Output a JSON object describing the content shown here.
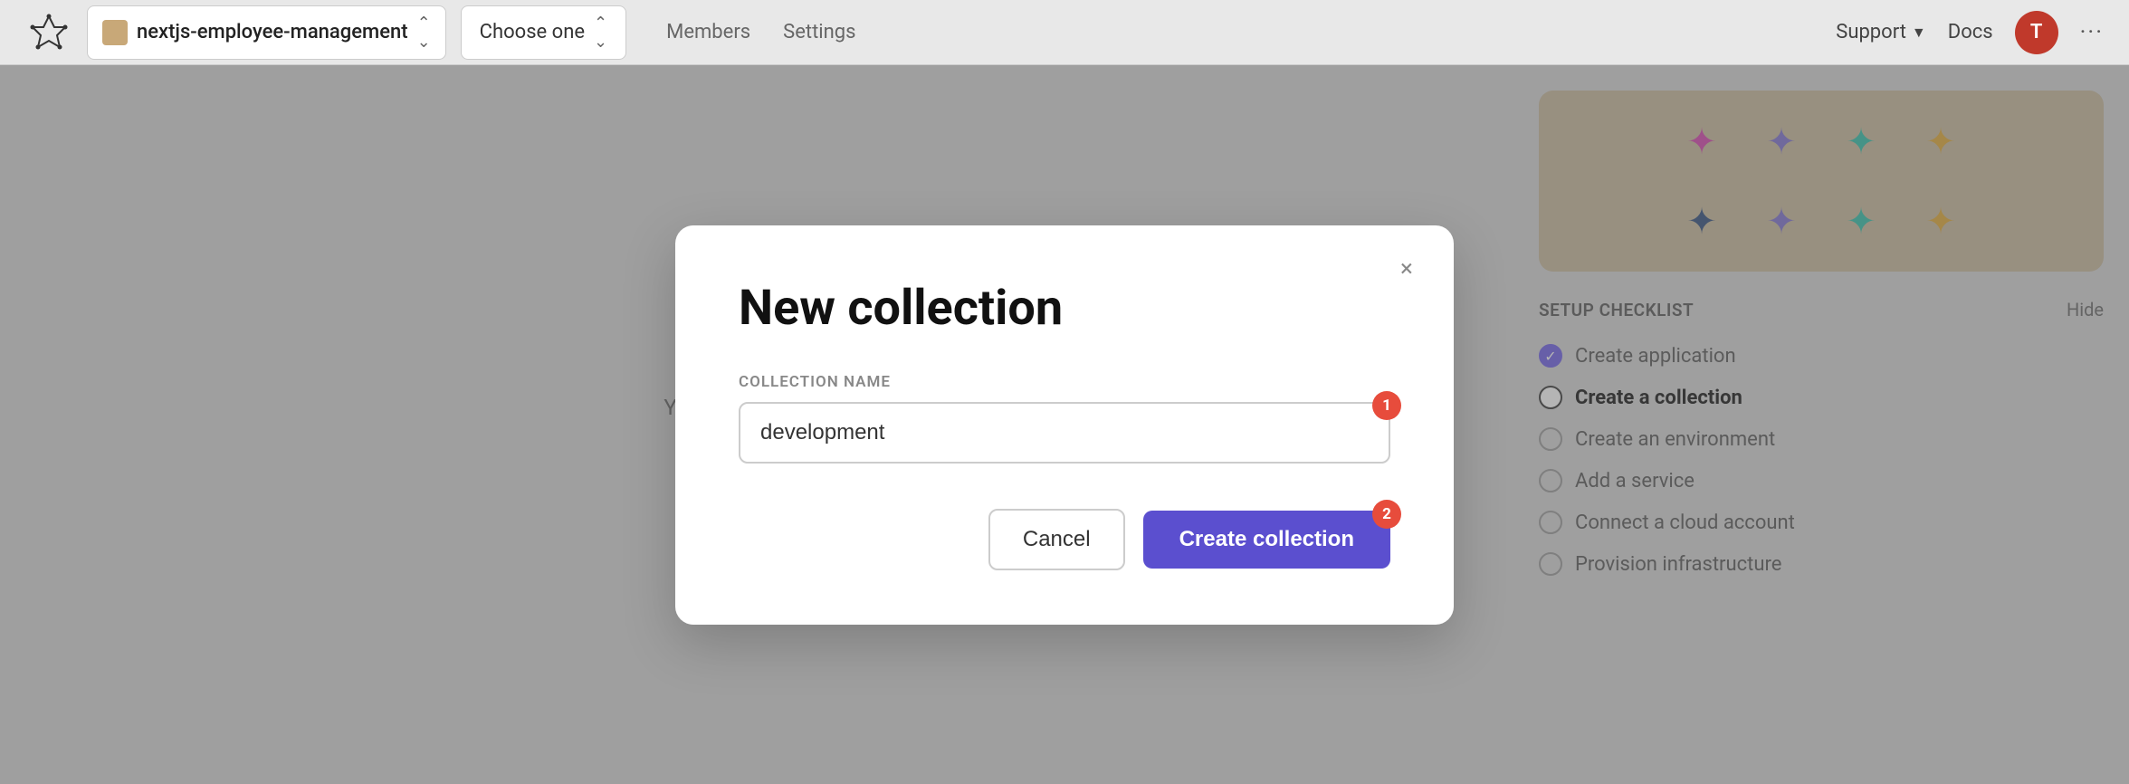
{
  "topbar": {
    "logo_name": "northflank-logo",
    "project_name": "nextjs-employee-management",
    "choose_one_label": "Choose one",
    "nav_items": [
      {
        "label": "Members",
        "key": "members"
      },
      {
        "label": "Settings",
        "key": "settings"
      }
    ],
    "support_label": "Support",
    "docs_label": "Docs",
    "avatar_letter": "T",
    "more_label": "···"
  },
  "left_panel": {
    "body_text": "You can use colle...\ncloud accoun..."
  },
  "right_panel": {
    "checklist_title": "SETUP CHECKLIST",
    "hide_label": "Hide",
    "checklist_items": [
      {
        "label": "Create application",
        "state": "completed"
      },
      {
        "label": "Create a collection",
        "state": "active"
      },
      {
        "label": "Create an environment",
        "state": "pending"
      },
      {
        "label": "Add a service",
        "state": "pending"
      },
      {
        "label": "Connect a cloud account",
        "state": "pending"
      },
      {
        "label": "Provision infrastructure",
        "state": "pending"
      }
    ]
  },
  "modal": {
    "title": "New collection",
    "field_label": "COLLECTION NAME",
    "input_value": "development",
    "input_placeholder": "development",
    "input_badge": "1",
    "cancel_label": "Cancel",
    "create_label": "Create collection",
    "create_badge": "2",
    "close_icon": "×"
  }
}
